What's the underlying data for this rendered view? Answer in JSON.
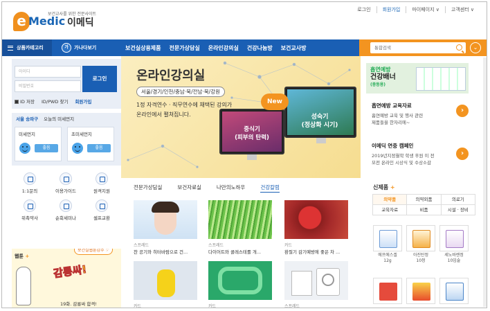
{
  "header": {
    "logo_sub": "보건교사를 위한 전문사이트",
    "logo_e": "e",
    "logo_medic": "Medic",
    "logo_ko": "이메딕",
    "util": [
      "로그인",
      "회원가입",
      "마이페이지 ∨",
      "고객센터 ∨"
    ]
  },
  "nav": {
    "category": "상품카테고리",
    "ga_circle": "가",
    "ga_label": "가나다보기",
    "menu": [
      "보건실상용제품",
      "전문가상담실",
      "온라인강의실",
      "건강나눔방",
      "보건교사방"
    ],
    "search_placeholder": "통합검색",
    "dd_icon": "⌄"
  },
  "login": {
    "id_placeholder": "아이디",
    "pw_placeholder": "비밀번호",
    "button": "로그인",
    "save_id": "ID 저장",
    "find": "ID/PWD 찾기",
    "join": "회원가입"
  },
  "dust": {
    "city": "서울 송파구",
    "title": "오늘의 미세먼지",
    "cards": [
      {
        "label": "미세먼지",
        "status": "좋음"
      },
      {
        "label": "초미세먼지",
        "status": "좋음"
      }
    ]
  },
  "services": [
    "1:1문의",
    "이용가이드",
    "원격지원",
    "위촉약사",
    "순회세미나",
    "셀프교환"
  ],
  "webtoon": {
    "label": "웹툰",
    "plus": "+",
    "tag": "보건실웹툰감주 ☞",
    "title": "감룡싸!",
    "sub": "19화. 감룡싸 합격!"
  },
  "banner": {
    "title": "온라인강의실",
    "regions": "서울/경기/인천/충남·북/전남·북/강원",
    "desc": [
      "1정 자격연수 · 직무연수에 채택된 강의가",
      "온라인에서 펼쳐집니다."
    ],
    "new": "New",
    "mon1": [
      "중식기",
      "(피부의 탄력)"
    ],
    "mon2": [
      "성숙기",
      "(정상화 시기)"
    ]
  },
  "tabs": [
    "전문가상담실",
    "보건자료실",
    "나만의노하우",
    "건강칼럼"
  ],
  "cards": [
    {
      "tag": "스프레드",
      "caption": "찬 공기와 히터바람으로 건..."
    },
    {
      "tag": "스프레드",
      "caption": "다이어트와 콜레스테롤 개..."
    },
    {
      "tag": "카드",
      "caption": "환절기 감기예방에 좋은 차 ..."
    },
    {
      "tag": "카드",
      "caption": ""
    },
    {
      "tag": "카드",
      "caption": ""
    },
    {
      "tag": "스프레드",
      "caption": ""
    }
  ],
  "right": {
    "ad_line1": "흡연예방",
    "ad_line2": "건강배너",
    "ad_line3": "(중등용)",
    "ad_sub": "",
    "info1": {
      "title": "흡연예방 교육자료",
      "desc": [
        "흡연예방 교육 및 행사 관련",
        "제품들을 한자리에~"
      ]
    },
    "info2": {
      "title": "이메딕 연중 캠페인",
      "desc": [
        "2019년지정월학 학생 후원 이 전",
        "모전 온라인 시상식 및 수상소감"
      ]
    },
    "arrow": "›",
    "new_products": "신제품",
    "plus": "+",
    "cats": [
      "의약품",
      "의약외품",
      "의료기",
      "교육자료",
      "비품",
      "시설 · 장비"
    ],
    "products": [
      {
        "name": "에프에스겔",
        "qty": "12g"
      },
      {
        "name": "아진탄정",
        "qty": "10정"
      },
      {
        "name": "세노바렌정",
        "qty": "10입술"
      },
      {
        "name": "",
        "qty": ""
      },
      {
        "name": "",
        "qty": ""
      },
      {
        "name": "",
        "qty": ""
      }
    ]
  },
  "colors": {
    "brand_blue": "#1a5fb4",
    "accent_orange": "#f39420"
  }
}
